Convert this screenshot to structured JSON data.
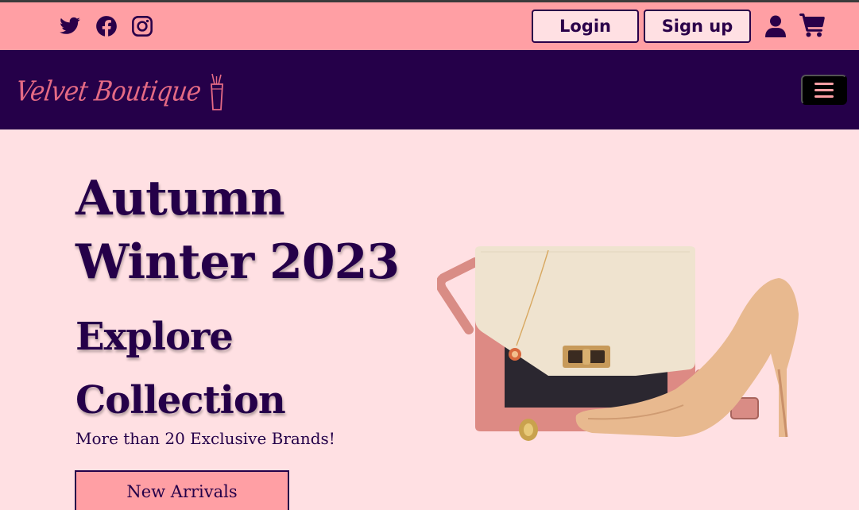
{
  "topbar": {
    "social": [
      "twitter-icon",
      "facebook-icon",
      "instagram-icon"
    ],
    "login_label": "Login",
    "signup_label": "Sign up",
    "icons": [
      "user-icon",
      "cart-icon"
    ]
  },
  "navbar": {
    "logo_text": "Velvet Boutique",
    "menu_icon": "hamburger-icon"
  },
  "hero": {
    "title_line1": "Autumn",
    "title_line2": "Winter 2023",
    "subtitle_line1": "Explore",
    "subtitle_line2": "Collection",
    "tagline": "More than 20 Exclusive Brands!",
    "cta_label": "New Arrivals"
  },
  "colors": {
    "topbar_bg": "#ff9fa4",
    "navbar_bg": "#250049",
    "page_bg": "#ffe0e3",
    "text_dark": "#250049",
    "logo_pink": "#e56a84"
  }
}
